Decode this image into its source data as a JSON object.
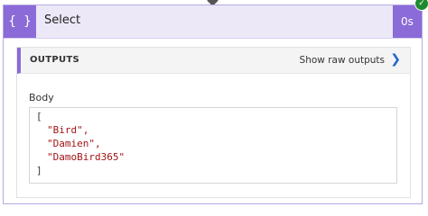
{
  "action": {
    "icon_glyph": "{ }",
    "title": "Select",
    "duration": "0s",
    "status": "succeeded"
  },
  "outputs": {
    "label": "OUTPUTS",
    "show_raw_label": "Show raw outputs"
  },
  "body": {
    "label": "Body",
    "open_bracket": "[",
    "items": [
      "\"Bird\",",
      "\"Damien\",",
      "\"DamoBird365\""
    ],
    "close_bracket": "]"
  },
  "colors": {
    "accent": "#8a6bd8",
    "success": "#1e8a2e",
    "link": "#2466c7",
    "string": "#a31515"
  }
}
